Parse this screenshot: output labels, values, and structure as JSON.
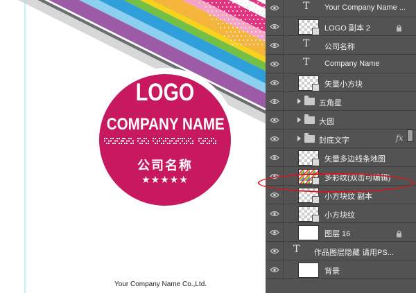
{
  "canvas": {
    "logo": "LOGO",
    "company_name": "COMPANY NAME",
    "company_name_cn": "公司名称",
    "stars": "★★★★★",
    "footer": "Your Company Name Co.,Ltd.",
    "stripe_colors": [
      "#f5a3c7",
      "#f4b53a",
      "#74bf44",
      "#2e9fd9",
      "#8dcff0",
      "#9c5ba7",
      "#6d6e71"
    ],
    "badge_color": "#c8185f"
  },
  "layers_panel": {
    "layers": [
      {
        "kind": "text",
        "name": "Your Company Name ..."
      },
      {
        "kind": "smart",
        "name": "LOGO 副本 2",
        "locked": true
      },
      {
        "kind": "text",
        "name": "公司名称"
      },
      {
        "kind": "text",
        "name": "Company Name"
      },
      {
        "kind": "smart",
        "name": "矢量小方块"
      },
      {
        "kind": "group",
        "name": "五角星"
      },
      {
        "kind": "group",
        "name": "大圆"
      },
      {
        "kind": "group",
        "name": "封底文字",
        "fx": "fx"
      },
      {
        "kind": "smart",
        "name": "矢量多边线条地图"
      },
      {
        "kind": "smart-colorful",
        "name": "多彩纹(双击可编辑)",
        "highlighted": true
      },
      {
        "kind": "smart",
        "name": "小方块纹 副本"
      },
      {
        "kind": "smart",
        "name": "小方块纹"
      },
      {
        "kind": "white",
        "name": "图层 16",
        "locked": true
      },
      {
        "kind": "text",
        "name": "作品图层隐藏 请用PS..."
      },
      {
        "kind": "white",
        "name": "背景"
      }
    ]
  }
}
